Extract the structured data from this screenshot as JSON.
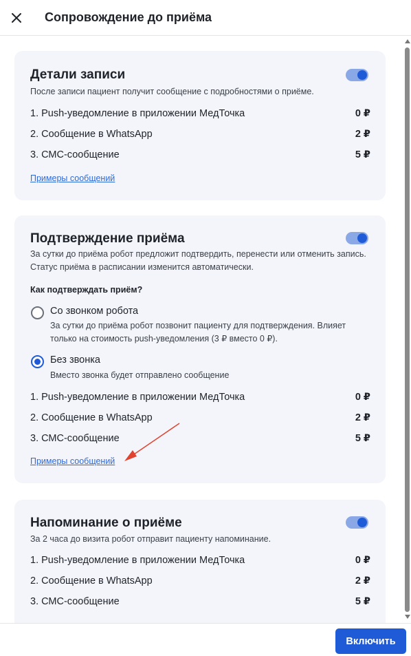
{
  "header": {
    "title": "Сопровождение до приёма",
    "close_icon": "close-icon"
  },
  "cards": [
    {
      "title": "Детали записи",
      "toggle_on": true,
      "description": "После записи пациент получит сообщение с подробностями о приёме.",
      "rows": [
        {
          "label": "1. Push-уведомление в приложении МедТочка",
          "price": "0 ₽"
        },
        {
          "label": "2. Сообщение в WhatsApp",
          "price": "2 ₽"
        },
        {
          "label": "3. СМС-сообщение",
          "price": "5 ₽"
        }
      ],
      "link": "Примеры сообщений"
    },
    {
      "title": "Подтверждение приёма",
      "toggle_on": true,
      "description": "За сутки до приёма робот предложит подтвердить, перенести или отменить запись. Статус приёма в расписании изменится автоматически.",
      "question": "Как подтверждать приём?",
      "options": [
        {
          "label": "Со звонком робота",
          "description": "За сутки до приёма робот позвонит пациенту для подтверждения. Влияет только на стоимость push-уведомления (3 ₽ вместо 0 ₽).",
          "checked": false
        },
        {
          "label": "Без звонка",
          "description": "Вместо звонка будет отправлено сообщение",
          "checked": true
        }
      ],
      "rows": [
        {
          "label": "1. Push-уведомление в приложении МедТочка",
          "price": "0 ₽"
        },
        {
          "label": "2. Сообщение в WhatsApp",
          "price": "2 ₽"
        },
        {
          "label": "3. СМС-сообщение",
          "price": "5 ₽"
        }
      ],
      "link": "Примеры сообщений"
    },
    {
      "title": "Напоминание о приёме",
      "toggle_on": true,
      "description": "За 2 часа до визита робот отправит пациенту напоминание.",
      "rows": [
        {
          "label": "1. Push-уведомление в приложении МедТочка",
          "price": "0 ₽"
        },
        {
          "label": "2. Сообщение в WhatsApp",
          "price": "2 ₽"
        },
        {
          "label": "3. СМС-сообщение",
          "price": "5 ₽"
        }
      ]
    }
  ],
  "footer": {
    "enable_label": "Включить"
  },
  "colors": {
    "accent": "#1f5bd6",
    "card_bg": "#f3f5fa",
    "link": "#2f6bd8",
    "arrow": "#e0432f"
  }
}
